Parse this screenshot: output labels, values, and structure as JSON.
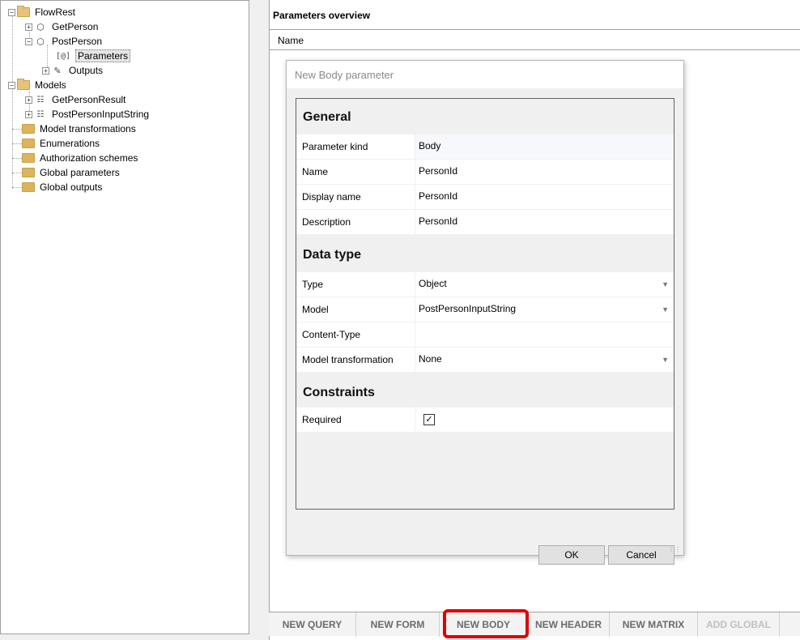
{
  "tree": {
    "items": [
      {
        "label": "FlowRest"
      },
      {
        "label": "GetPerson"
      },
      {
        "label": "PostPerson"
      },
      {
        "label": "Parameters"
      },
      {
        "label": "Outputs"
      },
      {
        "label": "Models"
      },
      {
        "label": "GetPersonResult"
      },
      {
        "label": "PostPersonInputString"
      },
      {
        "label": "Model transformations"
      },
      {
        "label": "Enumerations"
      },
      {
        "label": "Authorization schemes"
      },
      {
        "label": "Global parameters"
      },
      {
        "label": "Global outputs"
      }
    ],
    "param_icon_text": "[@]"
  },
  "main": {
    "title": "Parameters overview",
    "column_name": "Name"
  },
  "dialog": {
    "title": "New Body parameter",
    "sections": {
      "general": "General",
      "data_type": "Data type",
      "constraints": "Constraints"
    },
    "rows": {
      "parameter_kind": {
        "name": "Parameter kind",
        "value": "Body"
      },
      "name": {
        "name": "Name",
        "value": "PersonId"
      },
      "display_name": {
        "name": "Display name",
        "value": "PersonId"
      },
      "description": {
        "name": "Description",
        "value": "PersonId"
      },
      "type": {
        "name": "Type",
        "value": "Object"
      },
      "model": {
        "name": "Model",
        "value": "PostPersonInputString"
      },
      "content_type": {
        "name": "Content-Type",
        "value": ""
      },
      "model_transformation": {
        "name": "Model transformation",
        "value": "None"
      },
      "required": {
        "name": "Required",
        "checked": true
      }
    },
    "ok_label": "OK",
    "cancel_label": "Cancel"
  },
  "toolbar": {
    "new_query": "NEW QUERY",
    "new_form": "NEW FORM",
    "new_body": "NEW BODY",
    "new_header": "NEW HEADER",
    "new_matrix": "NEW MATRIX",
    "add_global": "ADD GLOBAL"
  },
  "colors": {
    "highlight": "#e00000"
  }
}
